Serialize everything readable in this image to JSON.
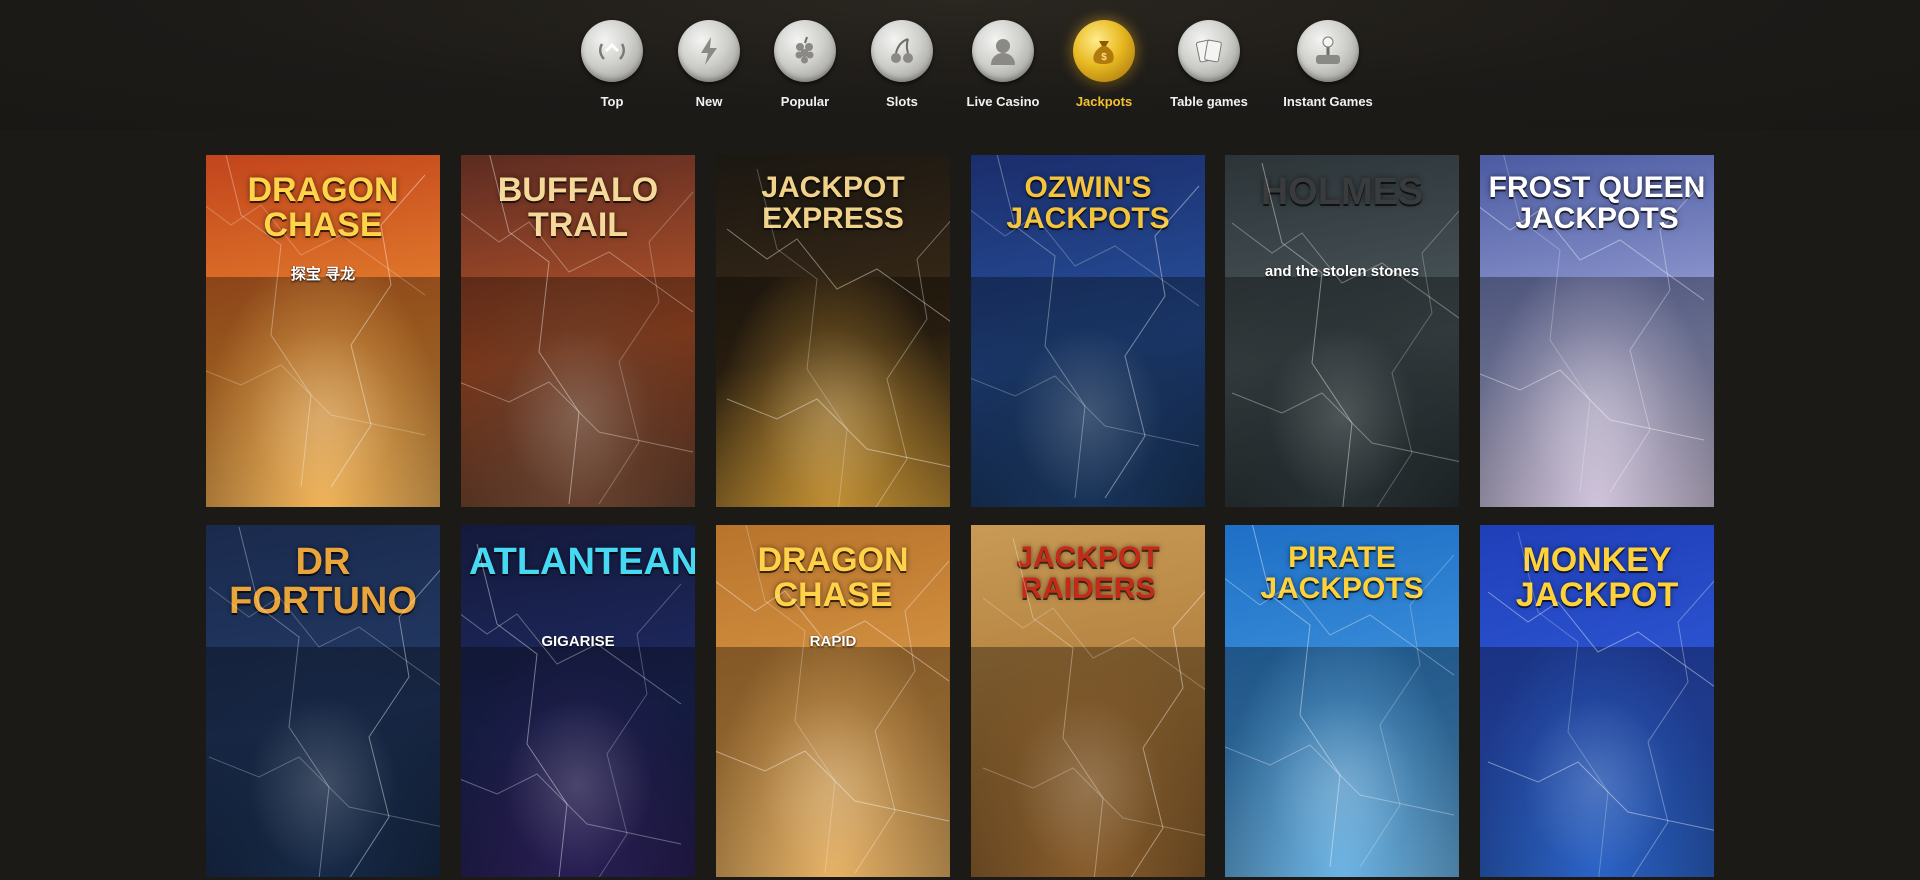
{
  "categories": [
    {
      "label": "Top",
      "icon": "laurel-arrow-icon",
      "active": false
    },
    {
      "label": "New",
      "icon": "lightning-icon",
      "active": false
    },
    {
      "label": "Popular",
      "icon": "grapes-icon",
      "active": false
    },
    {
      "label": "Slots",
      "icon": "cherries-icon",
      "active": false
    },
    {
      "label": "Live Casino",
      "icon": "dealer-bust-icon",
      "active": false
    },
    {
      "label": "Jackpots",
      "icon": "money-bag-icon",
      "active": true
    },
    {
      "label": "Table games",
      "icon": "playing-cards-icon",
      "active": false
    },
    {
      "label": "Instant Games",
      "icon": "joystick-icon",
      "active": false
    }
  ],
  "games": [
    {
      "title": "DRAGON CHASE",
      "subtitle": "探宝 寻龙",
      "colors": [
        "#c2441c",
        "#e8862f",
        "#f3b55a"
      ],
      "title_color": "#ffd34a"
    },
    {
      "title": "BUFFALO TRAIL",
      "subtitle": "",
      "colors": [
        "#5c2b22",
        "#b8552a",
        "#6a4330"
      ],
      "title_color": "#f4d99a"
    },
    {
      "title": "JACKPOT EXPRESS",
      "subtitle": "",
      "colors": [
        "#1b1712",
        "#3b2b17",
        "#c29034"
      ],
      "title_color": "#f1d28a"
    },
    {
      "title": "OZWIN'S JACKPOTS",
      "subtitle": "",
      "colors": [
        "#1b2d6b",
        "#27519c",
        "#18345a"
      ],
      "title_color": "#f5c43c"
    },
    {
      "title": "HOLMES",
      "subtitle": "and the stolen stones",
      "colors": [
        "#2c3438",
        "#4c585c",
        "#273033"
      ],
      "title_color": "#3a3b3c"
    },
    {
      "title": "FROST QUEEN JACKPOTS",
      "subtitle": "",
      "colors": [
        "#4b5aa2",
        "#9aa3d6",
        "#d2c6de"
      ],
      "title_color": "#ffffff"
    },
    {
      "title": "DR FORTUNO",
      "subtitle": "",
      "colors": [
        "#1a2a4d",
        "#233a66",
        "#172a48"
      ],
      "title_color": "#e9a43a"
    },
    {
      "title": "ATLANTEAN",
      "subtitle": "GIGARISE",
      "colors": [
        "#141a3c",
        "#1f2a63",
        "#291f55"
      ],
      "title_color": "#47d8f4"
    },
    {
      "title": "DRAGON CHASE",
      "subtitle": "RAPID",
      "colors": [
        "#b9742c",
        "#d79645",
        "#e9b467"
      ],
      "title_color": "#ffd24a"
    },
    {
      "title": "JACKPOT RAIDERS",
      "subtitle": "",
      "colors": [
        "#c79a55",
        "#b17d3c",
        "#8a5e2c"
      ],
      "title_color": "#c42a18"
    },
    {
      "title": "Pirate Jackpots",
      "subtitle": "",
      "colors": [
        "#1e6fc6",
        "#3e93dc",
        "#6db6e8"
      ],
      "title_color": "#ffd23a"
    },
    {
      "title": "MONKEY JACKPOT",
      "subtitle": "",
      "colors": [
        "#1f3fb8",
        "#2f58d6",
        "#2b64c9"
      ],
      "title_color": "#ffd23a"
    }
  ]
}
